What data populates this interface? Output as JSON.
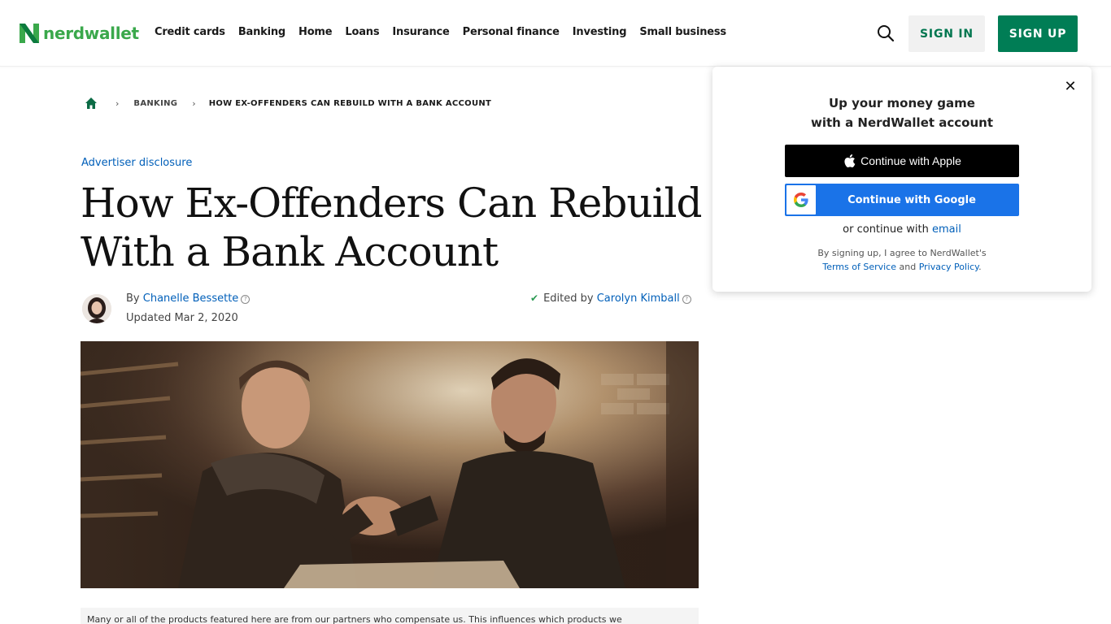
{
  "brand": {
    "name": "nerdwallet",
    "color": "#3aa84b",
    "primary": "#007d55"
  },
  "nav": {
    "items": [
      "Credit cards",
      "Banking",
      "Home",
      "Loans",
      "Insurance",
      "Personal finance",
      "Investing",
      "Small business"
    ],
    "sign_in": "SIGN IN",
    "sign_up": "SIGN UP",
    "search_icon": "search-icon"
  },
  "breadcrumb": {
    "home_icon": "home-icon",
    "section": "BANKING",
    "current": "HOW EX-OFFENDERS CAN REBUILD WITH A BANK ACCOUNT"
  },
  "article": {
    "disclosure": "Advertiser disclosure",
    "title": "How Ex-Offenders Can Rebuild With a Bank Account",
    "by_prefix": "By",
    "author": "Chanelle Bessette",
    "updated": "Updated Mar 2, 2020",
    "edited_prefix": "Edited by",
    "editor": "Carolyn Kimball",
    "partner_note": "Many or all of the products featured here are from our partners who compensate us. This influences which products we"
  },
  "popup": {
    "title_line1": "Up your money game",
    "title_line2": "with a NerdWallet account",
    "apple_label": "Continue with Apple",
    "google_label": "Continue with Google",
    "or_prefix": "or continue with",
    "email_link": "email",
    "terms_prefix": "By signing up, I agree to NerdWallet's",
    "terms_link": "Terms of Service",
    "terms_and": "and",
    "privacy_link": "Privacy Policy",
    "close_icon": "close-icon"
  }
}
